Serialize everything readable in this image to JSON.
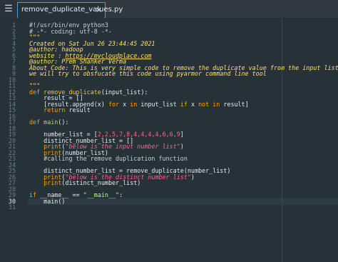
{
  "tab": {
    "sidebar_icon": "sidebar-toggle-icon",
    "filename": "remove_duplicate_values.py",
    "close_glyph": "×"
  },
  "editor": {
    "line_numbers": [
      "1",
      "2",
      "3",
      "4",
      "5",
      "6",
      "7",
      "8",
      "9",
      "10",
      "11",
      "12",
      "13",
      "14",
      "15",
      "16",
      "17",
      "18",
      "19",
      "20",
      "21",
      "22",
      "23",
      "24",
      "25",
      "26",
      "27",
      "28",
      "29",
      "30",
      "31"
    ],
    "current_line": 30,
    "lines": [
      [
        {
          "t": "#!/usr/bin/env python3",
          "c": "cm"
        }
      ],
      [
        {
          "t": "# -*- coding: utf-8 -*-",
          "c": "cm"
        }
      ],
      [
        {
          "t": "\"\"\"",
          "c": "doc"
        }
      ],
      [
        {
          "t": "Created on Sat Jun 26 23:44:45 2021",
          "c": "doc"
        }
      ],
      [
        {
          "t": "@author: hadoop",
          "c": "doc"
        }
      ],
      [
        {
          "t": "website : ",
          "c": "doc"
        },
        {
          "t": "https://mycloudplace.com",
          "c": "link"
        }
      ],
      [
        {
          "t": "@author: Prem Shanker Verma",
          "c": "doc"
        }
      ],
      [
        {
          "t": "About Code: This is very simple code to remove the duplicate value from the input list.",
          "c": "doc"
        }
      ],
      [
        {
          "t": "we will try to obsfucate this code using pyarmor command line tool",
          "c": "doc"
        }
      ],
      [],
      [
        {
          "t": "\"\"\"",
          "c": "doc"
        }
      ],
      [
        {
          "t": "def ",
          "c": "kw"
        },
        {
          "t": "remove_duplicate",
          "c": "fn"
        },
        {
          "t": "(input_list):",
          "c": ""
        }
      ],
      [
        {
          "t": "    result = []",
          "c": ""
        }
      ],
      [
        {
          "t": "    [result.append(x) ",
          "c": ""
        },
        {
          "t": "for",
          "c": "kw"
        },
        {
          "t": " x ",
          "c": ""
        },
        {
          "t": "in",
          "c": "kw"
        },
        {
          "t": " input_list ",
          "c": ""
        },
        {
          "t": "if",
          "c": "kw"
        },
        {
          "t": " x ",
          "c": ""
        },
        {
          "t": "not in",
          "c": "kw"
        },
        {
          "t": " result]",
          "c": ""
        }
      ],
      [
        {
          "t": "    ",
          "c": ""
        },
        {
          "t": "return",
          "c": "kw"
        },
        {
          "t": " result",
          "c": ""
        }
      ],
      [],
      [
        {
          "t": "def ",
          "c": "kw"
        },
        {
          "t": "main",
          "c": "fn"
        },
        {
          "t": "():",
          "c": ""
        }
      ],
      [],
      [
        {
          "t": "    number_list = [",
          "c": ""
        },
        {
          "t": "2,2,5,7,8,4,4,4,4,6,6,9",
          "c": "num"
        },
        {
          "t": "]",
          "c": ""
        }
      ],
      [
        {
          "t": "    distinct_number_list = []",
          "c": ""
        }
      ],
      [
        {
          "t": "    ",
          "c": ""
        },
        {
          "t": "print",
          "c": "bi"
        },
        {
          "t": "(",
          "c": ""
        },
        {
          "t": "\"below is the input number list\"",
          "c": "str"
        },
        {
          "t": ")",
          "c": ""
        }
      ],
      [
        {
          "t": "    ",
          "c": ""
        },
        {
          "t": "print",
          "c": "bi"
        },
        {
          "t": "(number_list)",
          "c": ""
        }
      ],
      [
        {
          "t": "    #calling the remove duplication function",
          "c": "cm"
        }
      ],
      [],
      [
        {
          "t": "    distinct_number_list = remove_duplicate(number_list)",
          "c": ""
        }
      ],
      [
        {
          "t": "    ",
          "c": ""
        },
        {
          "t": "print",
          "c": "bi"
        },
        {
          "t": "(",
          "c": ""
        },
        {
          "t": "\"below is the distinct number list\"",
          "c": "str"
        },
        {
          "t": ")",
          "c": ""
        }
      ],
      [
        {
          "t": "    ",
          "c": ""
        },
        {
          "t": "print",
          "c": "bi"
        },
        {
          "t": "(distinct_number_list)",
          "c": ""
        }
      ],
      [],
      [
        {
          "t": "if",
          "c": "kw"
        },
        {
          "t": " __name__ == ",
          "c": ""
        },
        {
          "t": "\"__main__\"",
          "c": "dstr"
        },
        {
          "t": ":",
          "c": ""
        }
      ],
      [
        {
          "t": "    main()",
          "c": ""
        }
      ],
      []
    ]
  }
}
